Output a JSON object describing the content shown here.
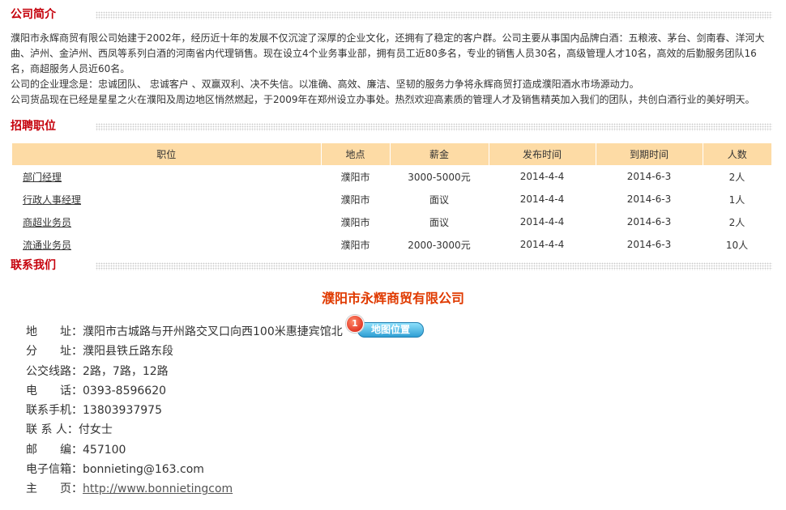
{
  "sections": {
    "intro_title": "公司简介",
    "jobs_title": "招聘职位",
    "contact_title": "联系我们"
  },
  "intro": {
    "p1": "濮阳市永辉商贸有限公司始建于2002年，经历近十年的发展不仅沉淀了深厚的企业文化，还拥有了稳定的客户群。公司主要从事国内品牌白酒：五粮液、茅台、剑南春、洋河大曲、泸州、金泸州、西凤等系列白酒的河南省内代理销售。现在设立4个业务事业部，拥有员工近80多名，专业的销售人员30名，高级管理人才10名，高效的后勤服务团队16名，商超服务人员近60名。",
    "p2": "公司的企业理念是：忠诚团队、 忠诚客户 、双赢双利、决不失信。以准确、高效、廉洁、坚韧的服务力争将永辉商贸打造成濮阳酒水市场源动力。",
    "p3": "公司货品现在已经是星星之火在濮阳及周边地区悄然燃起，于2009年在郑州设立办事处。热烈欢迎高素质的管理人才及销售精英加入我们的团队，共创白酒行业的美好明天。"
  },
  "jobs": {
    "headers": [
      "职位",
      "地点",
      "薪金",
      "发布时间",
      "到期时间",
      "人数"
    ],
    "rows": [
      [
        "部门经理",
        "濮阳市",
        "3000-5000元",
        "2014-4-4",
        "2014-6-3",
        "2人"
      ],
      [
        "行政人事经理",
        "濮阳市",
        "面议",
        "2014-4-4",
        "2014-6-3",
        "1人"
      ],
      [
        "商超业务员",
        "濮阳市",
        "面议",
        "2014-4-4",
        "2014-6-3",
        "2人"
      ],
      [
        "流通业务员",
        "濮阳市",
        "2000-3000元",
        "2014-4-4",
        "2014-6-3",
        "10人"
      ]
    ]
  },
  "contact": {
    "company": "濮阳市永辉商贸有限公司",
    "map_button": "地图位置",
    "map_badge": "1",
    "rows": [
      {
        "label": "地　　址：",
        "value": "濮阳市古城路与开州路交叉口向西100米惠捷宾馆北"
      },
      {
        "label": "分　　址：",
        "value": "濮阳县铁丘路东段"
      },
      {
        "label": "公交线路：",
        "value": "2路，7路，12路"
      },
      {
        "label": "电　　话：",
        "value": "0393-8596620"
      },
      {
        "label": "联系手机：",
        "value": "13803937975"
      },
      {
        "label": "联 系 人：",
        "value": "付女士"
      },
      {
        "label": "邮　　编：",
        "value": "457100"
      },
      {
        "label": "电子信箱：",
        "value": "bonnieting@163.com"
      },
      {
        "label": "主　　页：",
        "value": "http://www.bonnietingcom"
      }
    ]
  },
  "colors": {
    "section_title": "#c5000b",
    "table_header_bg": "#fddba5",
    "company_name": "#e03a00",
    "map_button": "#2f9fd3"
  }
}
